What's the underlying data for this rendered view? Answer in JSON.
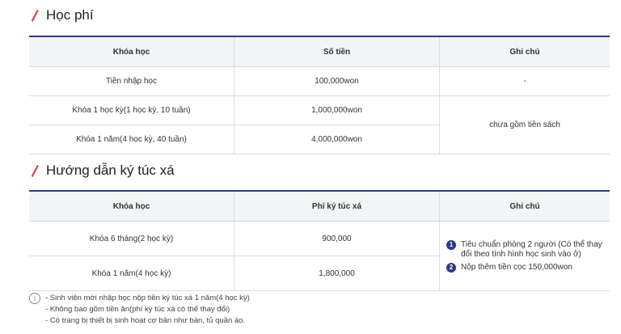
{
  "tuition": {
    "title": "Học phí",
    "headers": [
      "Khóa học",
      "Số tiền",
      "Ghi chú"
    ],
    "rows": [
      {
        "course": "Tiền nhập học",
        "amount": "100,000won",
        "note": "-"
      },
      {
        "course": "Khóa 1 học kỳ(1 học kỳ, 10 tuần)",
        "amount": "1,000,000won"
      },
      {
        "course": "Khóa 1 năm(4 học kỳ, 40 tuần)",
        "amount": "4,000,000won"
      }
    ],
    "merged_note": "chưa gồm tiền sách"
  },
  "dorm": {
    "title": "Hướng dẫn ký túc xá",
    "headers": [
      "Khóa học",
      "Phí ký túc xá",
      "Ghi chú"
    ],
    "rows": [
      {
        "course": "Khóa 6 tháng(2 học kỳ)",
        "fee": "900,000"
      },
      {
        "course": "Khóa 1 năm(4 học kỳ)",
        "fee": "1,800,000"
      }
    ],
    "notes": [
      {
        "num": "1",
        "text": "Tiêu chuẩn phòng 2 người (Có thể thay đổi theo tình hình học sinh vào ở)"
      },
      {
        "num": "2",
        "text": "Nộp thêm tiền cọc 150,000won"
      }
    ]
  },
  "info": {
    "icon": "i",
    "lines": [
      "- Sinh viên mới nhập học nộp tiền ký túc xá 1 năm(4 học kỳ)",
      "- Không bao gồm tiền ăn(phí ký túc xá có thể thay đổi)",
      "- Có trang bị thiết bị sinh hoạt cơ bản như bàn, tủ quần áo."
    ]
  },
  "colors": {
    "accent": "#2b3a8f",
    "header_bg": "#f3f4f6"
  }
}
